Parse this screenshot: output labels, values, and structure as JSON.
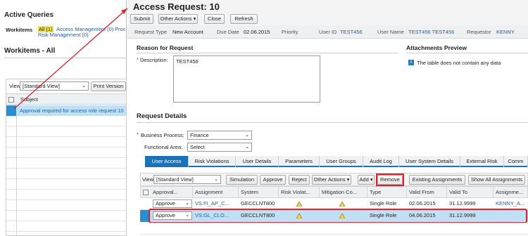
{
  "left_panel": {
    "title": "Active Queries",
    "workitems_label": "Workitems",
    "queries": [
      "All (1)",
      "Access Management (0)",
      "Proc",
      "Risk Management (0)"
    ],
    "section_title": "Workitems - All",
    "view_label": "View:",
    "view_value": "[Standard View]",
    "print_button": "Print Version",
    "column_subject": "Subject",
    "rows": [
      "Approval required for access role request 10"
    ]
  },
  "request": {
    "title": "Access Request:  10",
    "toolbar": {
      "submit": "Submit",
      "other_actions": "Other Actions",
      "close": "Close",
      "refresh": "Refresh"
    },
    "info": {
      "request_type_label": "Request Type",
      "request_type": "New Account",
      "due_date_label": "Due Date",
      "due_date": "02.06.2015",
      "priority_label": "Priority",
      "user_id_label": "User ID",
      "user_id": "TEST456",
      "user_name_label": "User Name",
      "user_name": "TEST456 TEST456",
      "requestor_label": "Requestor",
      "requestor": "KENNY"
    },
    "reason_title": "Reason for Request",
    "description_label": "Description:",
    "description_value": "TEST456",
    "attachments_title": "Attachments Preview",
    "attachments_empty": "The table does not contain any data",
    "details_title": "Request Details",
    "business_process_label": "Business Process:",
    "business_process_value": "Finance",
    "functional_area_label": "Functional Area:",
    "functional_area_value": "Select",
    "tabs": [
      "User Access",
      "Risk Violations",
      "User Details",
      "Parameters",
      "User Groups",
      "Audit Log",
      "User System Details",
      "External Risk",
      "Comm"
    ],
    "active_tab": "User Access",
    "table_toolbar": {
      "view_label": "View:",
      "view_value": "[Standard View]",
      "simulation": "Simulation",
      "approve": "Approve",
      "reject": "Reject",
      "other_actions": "Other Actions",
      "add": "Add",
      "remove": "Remove",
      "existing": "Existing Assignments",
      "show_all": "Show All Assignments"
    },
    "columns": [
      "Approval...",
      "Assignment",
      "System",
      "Risk Violat...",
      "Mitigation Co...",
      "Type",
      "Valid From",
      "Valid To",
      "Assignme..."
    ],
    "rows": [
      {
        "approval": "Approve",
        "assignment": "VS:FI_AP_C...",
        "system": "GECCLNT800",
        "type": "Single Role",
        "valid_from": "02.06.2015",
        "valid_to": "31.12.9999",
        "assignee": "KENNY_A..."
      },
      {
        "approval": "Approve",
        "assignment": "VS:GL_CLO...",
        "system": "GECCLNT800",
        "type": "Single Role",
        "valid_from": "04.06.2015",
        "valid_to": "31.12.9999",
        "assignee": ""
      }
    ]
  },
  "colors": {
    "accent_blue": "#1a73b8",
    "highlight_red": "#e0202a",
    "warning_yellow": "#f5d24a",
    "selected_row": "#bfe0f5"
  }
}
